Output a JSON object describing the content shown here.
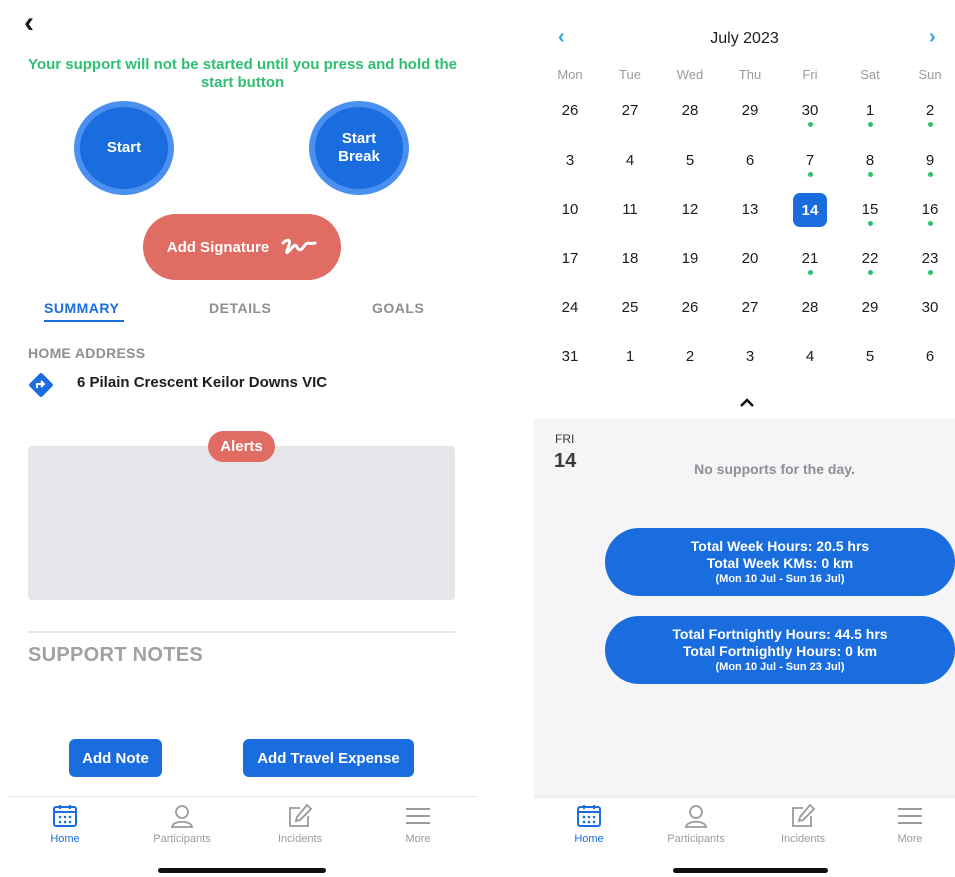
{
  "left": {
    "notice": "Your support will not be started until you press and hold the start button",
    "start_label": "Start",
    "start_break_label": "Start Break",
    "signature_label": "Add Signature",
    "tabs": [
      "SUMMARY",
      "DETAILS",
      "GOALS"
    ],
    "home_address_label": "HOME ADDRESS",
    "address": "6 Pilain Crescent Keilor Downs VIC",
    "alerts_label": "Alerts",
    "support_notes_label": "SUPPORT NOTES",
    "add_note_label": "Add Note",
    "add_travel_label": "Add Travel Expense"
  },
  "calendar": {
    "month": "July 2023",
    "weekdays": [
      "Mon",
      "Tue",
      "Wed",
      "Thu",
      "Fri",
      "Sat",
      "Sun"
    ],
    "weeks": [
      [
        "26",
        "27",
        "28",
        "29",
        "30",
        "1",
        "2"
      ],
      [
        "3",
        "4",
        "5",
        "6",
        "7",
        "8",
        "9"
      ],
      [
        "10",
        "11",
        "12",
        "13",
        "14",
        "15",
        "16"
      ],
      [
        "17",
        "18",
        "19",
        "20",
        "21",
        "22",
        "23"
      ],
      [
        "24",
        "25",
        "26",
        "27",
        "28",
        "29",
        "30"
      ],
      [
        "31",
        "1",
        "2",
        "3",
        "4",
        "5",
        "6"
      ]
    ],
    "dots": [
      [
        0,
        4
      ],
      [
        0,
        5
      ],
      [
        0,
        6
      ],
      [
        1,
        4
      ],
      [
        1,
        5
      ],
      [
        1,
        6
      ],
      [
        2,
        5
      ],
      [
        2,
        6
      ],
      [
        3,
        4
      ],
      [
        3,
        5
      ],
      [
        3,
        6
      ]
    ],
    "selected": [
      2,
      4
    ],
    "selected_weekday": "FRI",
    "selected_day": "14",
    "no_supports": "No supports for the day.",
    "week_summary": {
      "line1": "Total Week Hours: 20.5 hrs",
      "line2": "Total Week KMs: 0 km",
      "line3": "(Mon 10 Jul - Sun 16 Jul)"
    },
    "fortnight_summary": {
      "line1": "Total Fortnightly Hours: 44.5 hrs",
      "line2": "Total Fortnightly Hours: 0 km",
      "line3": "(Mon 10 Jul - Sun 23 Jul)"
    }
  },
  "tabbar": {
    "items": [
      {
        "label": "Home",
        "icon": "calendar-icon",
        "active": true
      },
      {
        "label": "Participants",
        "icon": "person-icon",
        "active": false
      },
      {
        "label": "Incidents",
        "icon": "edit-icon",
        "active": false
      },
      {
        "label": "More",
        "icon": "menu-icon",
        "active": false
      }
    ]
  },
  "colors": {
    "primary": "#1a6dde",
    "accent_red": "#e06c64",
    "success_green": "#2fbf71",
    "chevron": "#2aa8d6"
  }
}
